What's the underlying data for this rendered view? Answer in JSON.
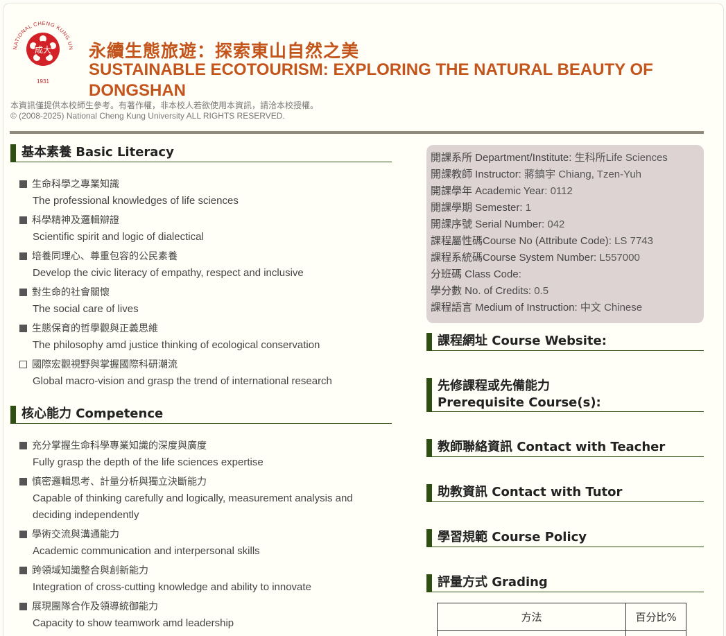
{
  "header": {
    "logo": {
      "text_top": "NATIONAL CHENG KUNG UNIVERSITY",
      "year": "1931",
      "emblem_char": "成大",
      "color": "#d32128"
    },
    "title_cn": "永續生態旅遊：探索東山自然之美",
    "title_en": "SUSTAINABLE ECOTOURISM: EXPLORING THE NATURAL BEAUTY OF DONGSHAN",
    "notice_cn": "本資訊僅提供本校師生參考。有著作權，非本校人若欲使用本資訊，請洽本校授權。",
    "notice_en": "© (2008-2025) National Cheng Kung University ALL RIGHTS RESERVED."
  },
  "colors": {
    "title": "#c3541c",
    "accent": "#2f4f12",
    "info_bg": "#ddd3d3"
  },
  "basic_literacy": {
    "heading": "基本素養 Basic Literacy",
    "items": [
      {
        "cn": "生命科學之專業知識",
        "en": "The professional knowledges of life sciences",
        "checked": true
      },
      {
        "cn": "科學精神及邏輯辯證",
        "en": "Scientific spirit and logic of dialectical",
        "checked": true
      },
      {
        "cn": "培養同理心、尊重包容的公民素養",
        "en": "Develop the civic literacy of empathy, respect and inclusive",
        "checked": true
      },
      {
        "cn": "對生命的社會關懷",
        "en": "The social care of lives",
        "checked": true
      },
      {
        "cn": "生態保育的哲學觀與正義思維",
        "en": "The philosophy amd justice thinking of ecological conservation",
        "checked": true
      },
      {
        "cn": "國際宏觀視野與掌握國際科研潮流",
        "en": "Global macro-vision and grasp the trend of international research",
        "checked": false
      }
    ]
  },
  "competence": {
    "heading": "核心能力 Competence",
    "items": [
      {
        "cn": "充分掌握生命科學專業知識的深度與廣度",
        "en": "Fully grasp the depth of the life sciences expertise",
        "checked": true
      },
      {
        "cn": "慎密邏輯思考、計量分析與獨立決斷能力",
        "en": "Capable of thinking carefully and logically, measurement analysis and deciding independently",
        "checked": true
      },
      {
        "cn": "學術交流與溝通能力",
        "en": "Academic communication and interpersonal skills",
        "checked": true
      },
      {
        "cn": "跨領域知識整合與創新能力",
        "en": "Integration of cross-cutting knowledge and ability to innovate",
        "checked": true
      },
      {
        "cn": "展現團隊合作及領導統御能力",
        "en": "Capacity to show teamwork amd leadership",
        "checked": true
      }
    ]
  },
  "info": {
    "department": {
      "label": "開課系所 Department/Institute: ",
      "value": "生科所Life Sciences"
    },
    "instructor": {
      "label": "開課教師 Instructor: ",
      "value": "蔣鎮宇 Chiang, Tzen-Yuh"
    },
    "year": {
      "label": "開課學年 Academic Year: ",
      "value": "0112"
    },
    "semester": {
      "label": "開課學期 Semester: ",
      "value": "1"
    },
    "serial": {
      "label": "開課序號 Serial Number: ",
      "value": "042"
    },
    "course_no": {
      "label": "課程屬性碼Course No (Attribute Code): ",
      "value": "LS 7743"
    },
    "system_no": {
      "label": "課程系統碼Course System Number: ",
      "value": "L557000"
    },
    "class_code": {
      "label": "分班碼 Class Code: ",
      "value": ""
    },
    "credits": {
      "label": "學分數 No. of Credits: ",
      "value": "0.5"
    },
    "medium": {
      "label": "課程語言 Medium of Instruction: ",
      "value": "中文 Chinese"
    }
  },
  "right_sections": {
    "website": "課程網址 Course Website:",
    "prereq_cn": "先修課程或先備能力",
    "prereq_en": "Prerequisite Course(s):",
    "contact_teacher": "教師聯絡資訊 Contact with Teacher",
    "contact_tutor": "助教資訊 Contact with Tutor",
    "policy": "學習規範 Course Policy",
    "grading": "評量方式 Grading"
  },
  "grading_table": {
    "col_method": "方法",
    "col_percent": "百分比%"
  }
}
